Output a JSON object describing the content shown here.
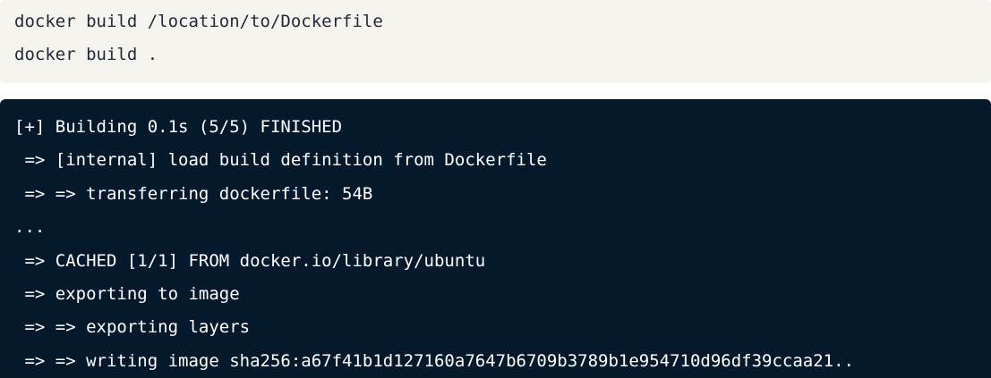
{
  "command_block": {
    "lines": [
      "docker build /location/to/Dockerfile",
      "docker build ."
    ]
  },
  "output_block": {
    "lines": [
      "[+] Building 0.1s (5/5) FINISHED",
      " => [internal] load build definition from Dockerfile",
      " => => transferring dockerfile: 54B",
      "...",
      " => CACHED [1/1] FROM docker.io/library/ubuntu",
      " => exporting to image",
      " => => exporting layers",
      " => => writing image sha256:a67f41b1d127160a7647b6709b3789b1e954710d96df39ccaa21.."
    ]
  },
  "colors": {
    "command_bg": "#f5f3ee",
    "command_text": "#1f2937",
    "output_bg": "#05192d",
    "output_text": "#ffffff"
  }
}
